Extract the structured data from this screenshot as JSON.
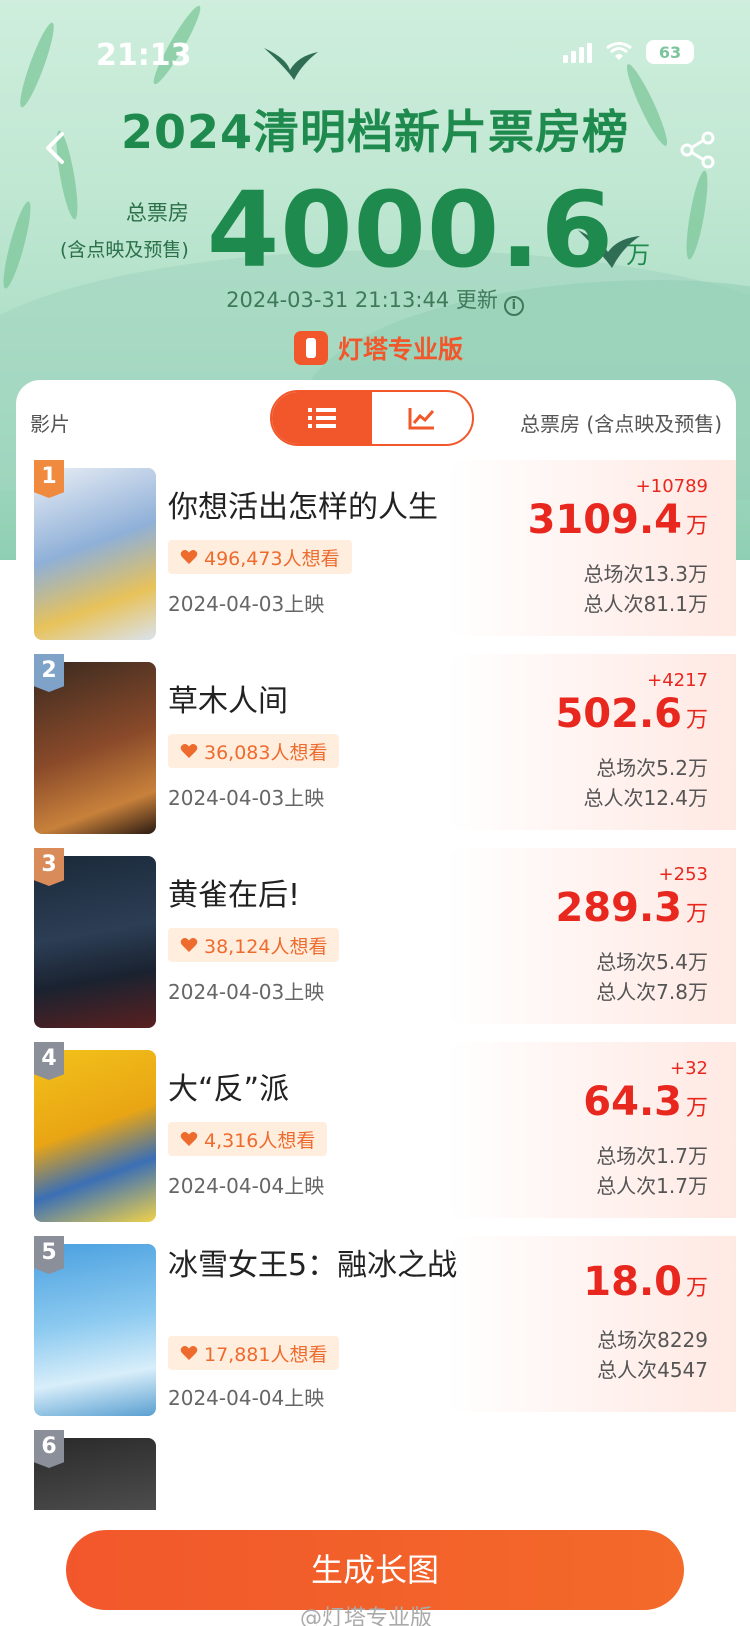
{
  "status_bar": {
    "time": "21:13",
    "battery": "63"
  },
  "header": {
    "title": "2024清明档新片票房榜",
    "total_label_1": "总票房",
    "total_label_2": "(含点映及预售)",
    "total_value": "4000.6",
    "total_unit": "万",
    "updated": "2024-03-31 21:13:44 更新",
    "brand": "灯塔专业版"
  },
  "table_head": {
    "film": "影片",
    "box": "总票房 (含点映及预售)",
    "view_mode": "list"
  },
  "films": [
    {
      "rank": "1",
      "name": "你想活出怎样的人生",
      "want": "496,473人想看",
      "release": "2024-04-03上映",
      "increment": "+10789",
      "box": "3109.4",
      "unit": "万",
      "shows": "总场次13.3万",
      "admissions": "总人次81.1万"
    },
    {
      "rank": "2",
      "name": "草木人间",
      "want": "36,083人想看",
      "release": "2024-04-03上映",
      "increment": "+4217",
      "box": "502.6",
      "unit": "万",
      "shows": "总场次5.2万",
      "admissions": "总人次12.4万"
    },
    {
      "rank": "3",
      "name": "黄雀在后!",
      "want": "38,124人想看",
      "release": "2024-04-03上映",
      "increment": "+253",
      "box": "289.3",
      "unit": "万",
      "shows": "总场次5.4万",
      "admissions": "总人次7.8万"
    },
    {
      "rank": "4",
      "name": "大“反”派",
      "want": "4,316人想看",
      "release": "2024-04-04上映",
      "increment": "+32",
      "box": "64.3",
      "unit": "万",
      "shows": "总场次1.7万",
      "admissions": "总人次1.7万"
    },
    {
      "rank": "5",
      "name": "冰雪女王5：融冰之战",
      "want": "17,881人想看",
      "release": "2024-04-04上映",
      "increment": "",
      "box": "18.0",
      "unit": "万",
      "shows": "总场次8229",
      "admissions": "总人次4547"
    },
    {
      "rank": "6"
    }
  ],
  "footer": {
    "button": "生成长图",
    "watermark": "@灯塔专业版"
  },
  "colors": {
    "brand_orange": "#f2572b",
    "title_green": "#1f8a4d",
    "box_red": "#e8281e"
  }
}
